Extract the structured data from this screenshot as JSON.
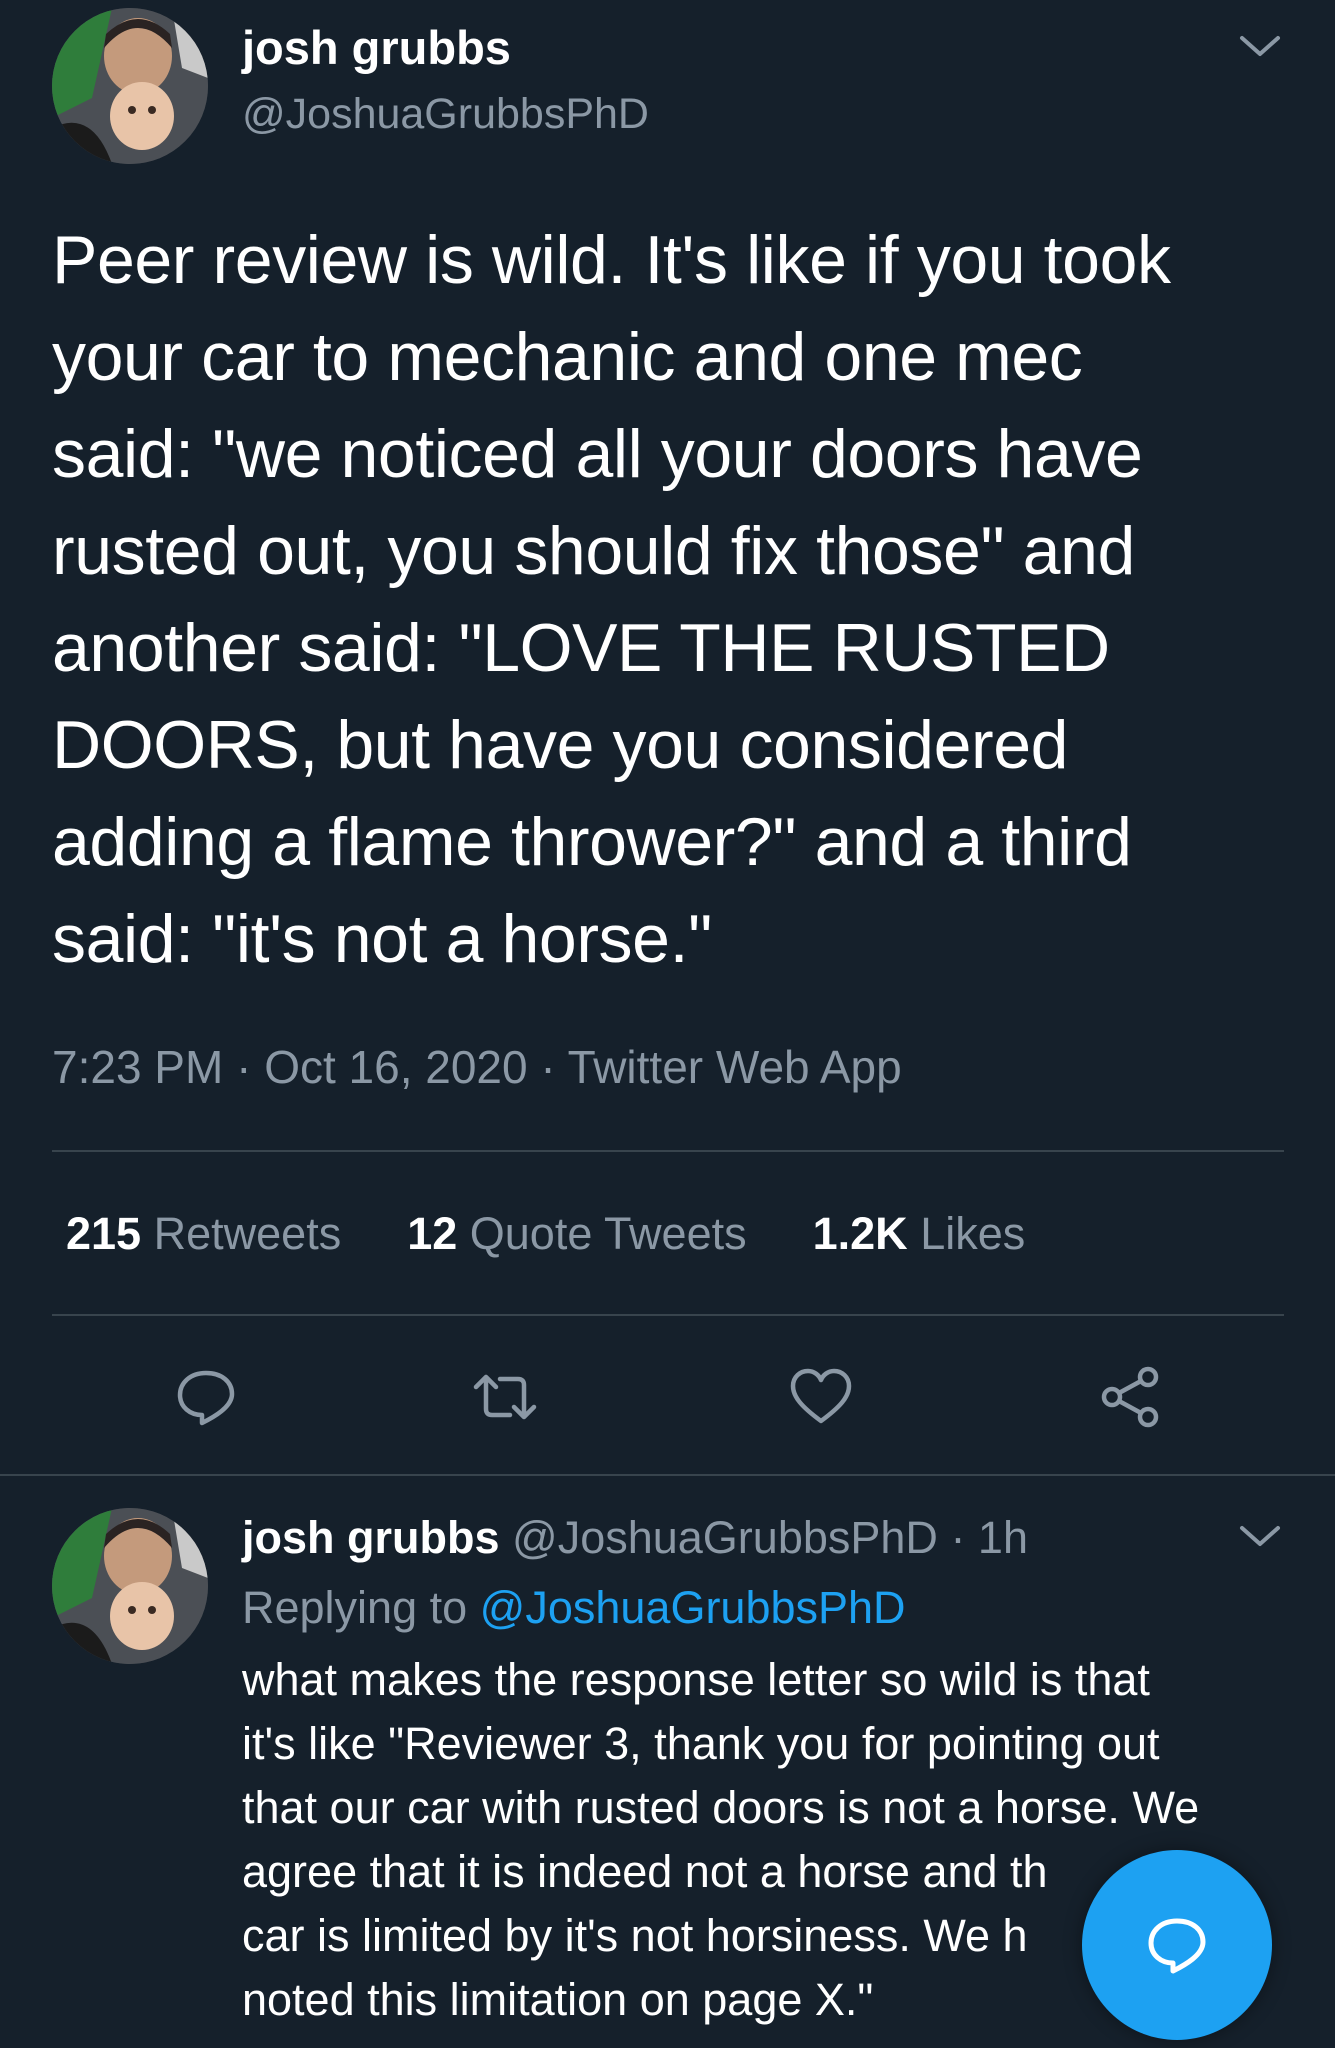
{
  "tweet": {
    "author_name": "josh grubbs",
    "author_handle": "@JoshuaGrubbsPhD",
    "text": "Peer review is wild. It's like if you took\nyour car to mechanic and one mec\nsaid: \"we noticed all your doors have\nrusted out, you should fix those\" and\nanother said: \"LOVE THE RUSTED\nDOORS, but have you considered\nadding a flame thrower?\" and a third\nsaid: \"it's not a horse.\"",
    "timestamp": "7:23 PM · Oct 16, 2020 · Twitter Web App",
    "stats": {
      "retweets_count": "215",
      "retweets_label": "Retweets",
      "quotes_count": "12",
      "quotes_label": "Quote Tweets",
      "likes_count": "1.2K",
      "likes_label": "Likes"
    },
    "actions": [
      "reply-icon",
      "retweet-icon",
      "like-icon",
      "share-icon"
    ]
  },
  "reply": {
    "author_name": "josh grubbs",
    "author_handle": "@JoshuaGrubbsPhD",
    "time": "· 1h",
    "replying_to_label": "Replying to",
    "replying_to_handle": "@JoshuaGrubbsPhD",
    "text": "what makes the response letter so wild is that\nit's like \"Reviewer 3, thank you for pointing out\nthat our car with rusted doors is not a horse. We\nagree that it is indeed not a horse and th\ncar is limited by it's not horsiness. We h\nnoted this limitation on page X.\""
  },
  "colors": {
    "background": "#15202b",
    "accent": "#1da1f2",
    "secondary_text": "#8b98a5",
    "divider": "#38444d"
  },
  "fab_icon": "compose-reply-icon"
}
